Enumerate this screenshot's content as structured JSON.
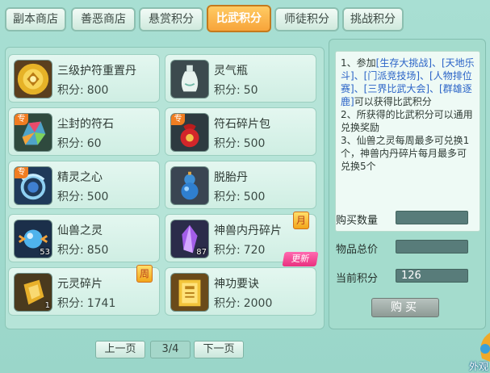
{
  "tabs": [
    {
      "label": "副本商店"
    },
    {
      "label": "善恶商店"
    },
    {
      "label": "悬赏积分"
    },
    {
      "label": "比武积分",
      "active": true
    },
    {
      "label": "师徒积分"
    },
    {
      "label": "挑战积分"
    }
  ],
  "price_label": "积分:",
  "items": [
    {
      "name": "三级护符重置丹",
      "price": "800",
      "icon": "gold-amulet-pill-icon"
    },
    {
      "name": "灵气瓶",
      "price": "50",
      "icon": "porcelain-vase-icon"
    },
    {
      "name": "尘封的符石",
      "price": "60",
      "icon": "rune-stone-icon",
      "tag": "专"
    },
    {
      "name": "符石碎片包",
      "price": "500",
      "icon": "red-pouch-icon",
      "tag": "专"
    },
    {
      "name": "精灵之心",
      "price": "500",
      "icon": "spirit-heart-icon",
      "tag": "专"
    },
    {
      "name": "脱胎丹",
      "price": "500",
      "icon": "gourd-pill-icon"
    },
    {
      "name": "仙兽之灵",
      "price": "850",
      "icon": "beast-spirit-orb-icon",
      "count": "53"
    },
    {
      "name": "神兽内丹碎片",
      "price": "720",
      "icon": "purple-crystal-icon",
      "count": "87",
      "badge": "月",
      "new": "更新"
    },
    {
      "name": "元灵碎片",
      "price": "1741",
      "icon": "gold-fragment-icon",
      "count": "1",
      "badge": "周"
    },
    {
      "name": "神功要诀",
      "price": "2000",
      "icon": "gold-book-icon"
    }
  ],
  "pager": {
    "prev_label": "上一页",
    "page": "3/4",
    "next_label": "下一页"
  },
  "description": {
    "line1_prefix": "1、参加",
    "line1_links": "[生存大挑战]、[天地乐斗]、[门派竞技场]、[人物排位赛]、[三界比武大会]、[群雄逐鹿]",
    "line1_suffix": "可以获得比武积分",
    "line2": "2、所获得的比武积分可以通用兑换奖励",
    "line3": "3、仙兽之灵每周最多可兑换1个，神兽内丹碎片每月最多可兑换5个"
  },
  "form": {
    "quantity_label": "购买数量",
    "quantity_value": "",
    "total_label": "物品总价",
    "total_value": "",
    "current_label": "当前积分",
    "current_value": "126"
  },
  "buy_label": "购买",
  "corner_text": "外观",
  "colors": {
    "accent": "#f7a43a",
    "link": "#2a63c7",
    "panel_bg": "#b6e4d8"
  }
}
